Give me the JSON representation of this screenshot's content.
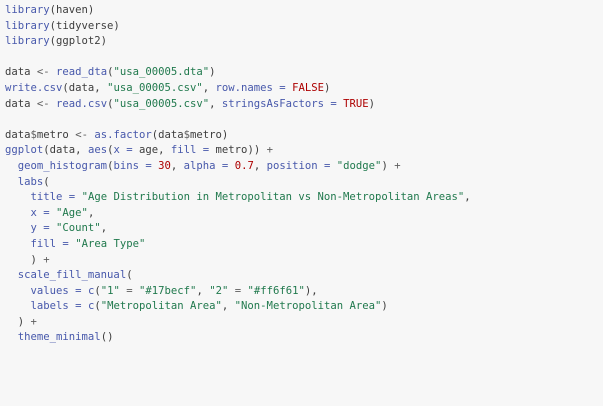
{
  "code_view": {
    "language": "R",
    "colors": {
      "background": "#f7f7f7",
      "default": "#3d3d3d",
      "function": "#4758ab",
      "string": "#20794d",
      "number": "#ad0000",
      "keyword": "#ad0000"
    },
    "lines": [
      [
        {
          "t": "fn",
          "s": "library"
        },
        {
          "t": "txt",
          "s": "(haven)"
        }
      ],
      [
        {
          "t": "fn",
          "s": "library"
        },
        {
          "t": "txt",
          "s": "(tidyverse)"
        }
      ],
      [
        {
          "t": "fn",
          "s": "library"
        },
        {
          "t": "txt",
          "s": "(ggplot2)"
        }
      ],
      [],
      [
        {
          "t": "txt",
          "s": "data "
        },
        {
          "t": "op",
          "s": "<-"
        },
        {
          "t": "txt",
          "s": " "
        },
        {
          "t": "fn",
          "s": "read_dta"
        },
        {
          "t": "txt",
          "s": "("
        },
        {
          "t": "str",
          "s": "\"usa_00005.dta\""
        },
        {
          "t": "txt",
          "s": ")"
        }
      ],
      [
        {
          "t": "fn",
          "s": "write.csv"
        },
        {
          "t": "txt",
          "s": "(data, "
        },
        {
          "t": "str",
          "s": "\"usa_00005.csv\""
        },
        {
          "t": "txt",
          "s": ", "
        },
        {
          "t": "fn",
          "s": "row.names ="
        },
        {
          "t": "txt",
          "s": " "
        },
        {
          "t": "kw",
          "s": "FALSE"
        },
        {
          "t": "txt",
          "s": ")"
        }
      ],
      [
        {
          "t": "txt",
          "s": "data "
        },
        {
          "t": "op",
          "s": "<-"
        },
        {
          "t": "txt",
          "s": " "
        },
        {
          "t": "fn",
          "s": "read.csv"
        },
        {
          "t": "txt",
          "s": "("
        },
        {
          "t": "str",
          "s": "\"usa_00005.csv\""
        },
        {
          "t": "txt",
          "s": ", "
        },
        {
          "t": "fn",
          "s": "stringsAsFactors ="
        },
        {
          "t": "txt",
          "s": " "
        },
        {
          "t": "kw",
          "s": "TRUE"
        },
        {
          "t": "txt",
          "s": ")"
        }
      ],
      [],
      [
        {
          "t": "txt",
          "s": "data"
        },
        {
          "t": "op",
          "s": "$"
        },
        {
          "t": "txt",
          "s": "metro "
        },
        {
          "t": "op",
          "s": "<-"
        },
        {
          "t": "txt",
          "s": " "
        },
        {
          "t": "fn",
          "s": "as.factor"
        },
        {
          "t": "txt",
          "s": "(data"
        },
        {
          "t": "op",
          "s": "$"
        },
        {
          "t": "txt",
          "s": "metro)"
        }
      ],
      [
        {
          "t": "fn",
          "s": "ggplot"
        },
        {
          "t": "txt",
          "s": "(data, "
        },
        {
          "t": "fn",
          "s": "aes"
        },
        {
          "t": "txt",
          "s": "("
        },
        {
          "t": "fn",
          "s": "x ="
        },
        {
          "t": "txt",
          "s": " age, "
        },
        {
          "t": "fn",
          "s": "fill ="
        },
        {
          "t": "txt",
          "s": " metro)) "
        },
        {
          "t": "op",
          "s": "+"
        }
      ],
      [
        {
          "t": "txt",
          "s": "  "
        },
        {
          "t": "fn",
          "s": "geom_histogram"
        },
        {
          "t": "txt",
          "s": "("
        },
        {
          "t": "fn",
          "s": "bins ="
        },
        {
          "t": "txt",
          "s": " "
        },
        {
          "t": "num",
          "s": "30"
        },
        {
          "t": "txt",
          "s": ", "
        },
        {
          "t": "fn",
          "s": "alpha ="
        },
        {
          "t": "txt",
          "s": " "
        },
        {
          "t": "num",
          "s": "0.7"
        },
        {
          "t": "txt",
          "s": ", "
        },
        {
          "t": "fn",
          "s": "position ="
        },
        {
          "t": "txt",
          "s": " "
        },
        {
          "t": "str",
          "s": "\"dodge\""
        },
        {
          "t": "txt",
          "s": ") "
        },
        {
          "t": "op",
          "s": "+"
        }
      ],
      [
        {
          "t": "txt",
          "s": "  "
        },
        {
          "t": "fn",
          "s": "labs"
        },
        {
          "t": "txt",
          "s": "("
        }
      ],
      [
        {
          "t": "txt",
          "s": "    "
        },
        {
          "t": "fn",
          "s": "title ="
        },
        {
          "t": "txt",
          "s": " "
        },
        {
          "t": "str",
          "s": "\"Age Distribution in Metropolitan vs Non-Metropolitan Areas\""
        },
        {
          "t": "txt",
          "s": ","
        }
      ],
      [
        {
          "t": "txt",
          "s": "    "
        },
        {
          "t": "fn",
          "s": "x ="
        },
        {
          "t": "txt",
          "s": " "
        },
        {
          "t": "str",
          "s": "\"Age\""
        },
        {
          "t": "txt",
          "s": ","
        }
      ],
      [
        {
          "t": "txt",
          "s": "    "
        },
        {
          "t": "fn",
          "s": "y ="
        },
        {
          "t": "txt",
          "s": " "
        },
        {
          "t": "str",
          "s": "\"Count\""
        },
        {
          "t": "txt",
          "s": ","
        }
      ],
      [
        {
          "t": "txt",
          "s": "    "
        },
        {
          "t": "fn",
          "s": "fill ="
        },
        {
          "t": "txt",
          "s": " "
        },
        {
          "t": "str",
          "s": "\"Area Type\""
        }
      ],
      [
        {
          "t": "txt",
          "s": "    ) "
        },
        {
          "t": "op",
          "s": "+"
        }
      ],
      [
        {
          "t": "txt",
          "s": "  "
        },
        {
          "t": "fn",
          "s": "scale_fill_manual"
        },
        {
          "t": "txt",
          "s": "("
        }
      ],
      [
        {
          "t": "txt",
          "s": "    "
        },
        {
          "t": "fn",
          "s": "values ="
        },
        {
          "t": "txt",
          "s": " "
        },
        {
          "t": "fn",
          "s": "c"
        },
        {
          "t": "txt",
          "s": "("
        },
        {
          "t": "str",
          "s": "\"1\""
        },
        {
          "t": "txt",
          "s": " "
        },
        {
          "t": "op",
          "s": "="
        },
        {
          "t": "txt",
          "s": " "
        },
        {
          "t": "str",
          "s": "\"#17becf\""
        },
        {
          "t": "txt",
          "s": ", "
        },
        {
          "t": "str",
          "s": "\"2\""
        },
        {
          "t": "txt",
          "s": " "
        },
        {
          "t": "op",
          "s": "="
        },
        {
          "t": "txt",
          "s": " "
        },
        {
          "t": "str",
          "s": "\"#ff6f61\""
        },
        {
          "t": "txt",
          "s": "),"
        }
      ],
      [
        {
          "t": "txt",
          "s": "    "
        },
        {
          "t": "fn",
          "s": "labels ="
        },
        {
          "t": "txt",
          "s": " "
        },
        {
          "t": "fn",
          "s": "c"
        },
        {
          "t": "txt",
          "s": "("
        },
        {
          "t": "str",
          "s": "\"Metropolitan Area\""
        },
        {
          "t": "txt",
          "s": ", "
        },
        {
          "t": "str",
          "s": "\"Non-Metropolitan Area\""
        },
        {
          "t": "txt",
          "s": ")"
        }
      ],
      [
        {
          "t": "txt",
          "s": "  ) "
        },
        {
          "t": "op",
          "s": "+"
        }
      ],
      [
        {
          "t": "txt",
          "s": "  "
        },
        {
          "t": "fn",
          "s": "theme_minimal"
        },
        {
          "t": "txt",
          "s": "()"
        }
      ]
    ]
  }
}
